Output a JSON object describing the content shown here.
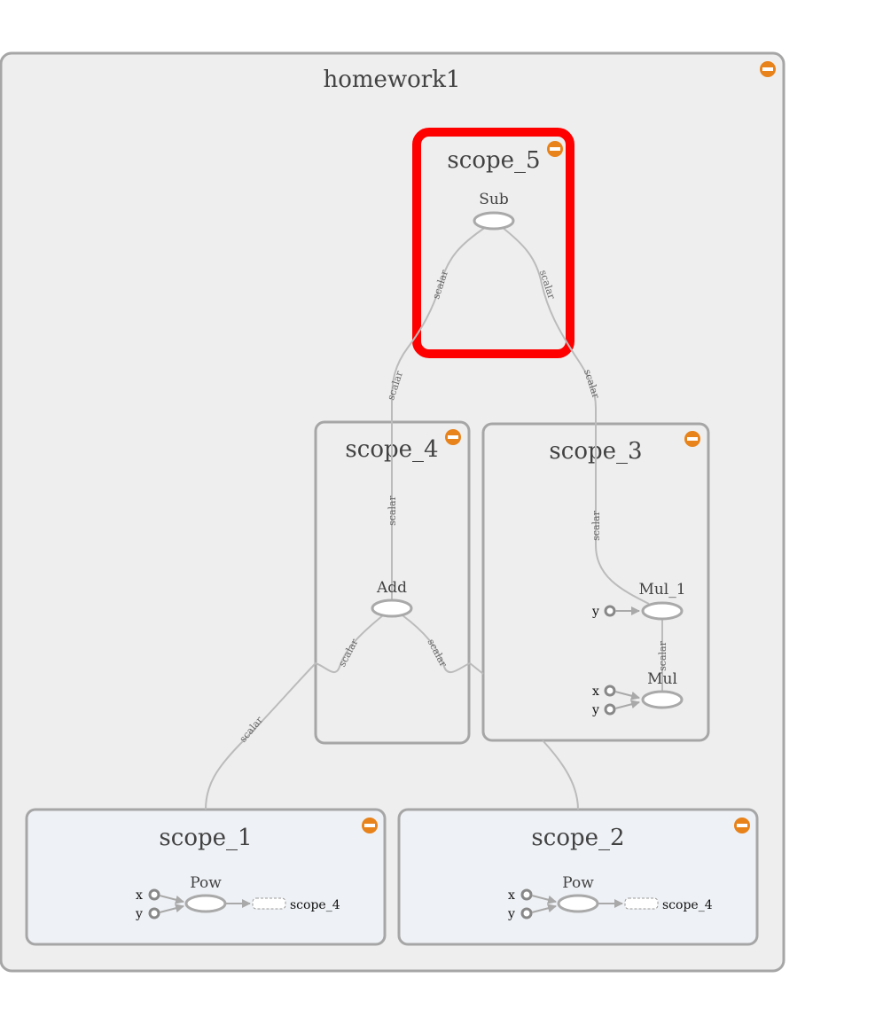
{
  "graph_title": "homework1",
  "scopes": {
    "scope_5": {
      "title": "scope_5",
      "op": "Sub"
    },
    "scope_4": {
      "title": "scope_4",
      "op": "Add"
    },
    "scope_3": {
      "title": "scope_3",
      "op_upper": "Mul_1",
      "op_lower": "Mul"
    },
    "scope_1": {
      "title": "scope_1",
      "op": "Pow",
      "output_ref": "scope_4"
    },
    "scope_2": {
      "title": "scope_2",
      "op": "Pow",
      "output_ref": "scope_4"
    }
  },
  "ports": {
    "x": "x",
    "y": "y"
  },
  "edge_label": "scalar",
  "colors": {
    "selection_outline": "#ff0000",
    "collapse_button": "#e8821a",
    "outer_fill": "#eeeeee",
    "leaf_scope_fill": "#eef1f5"
  },
  "icons": {
    "collapse": "minus-circle-icon"
  }
}
